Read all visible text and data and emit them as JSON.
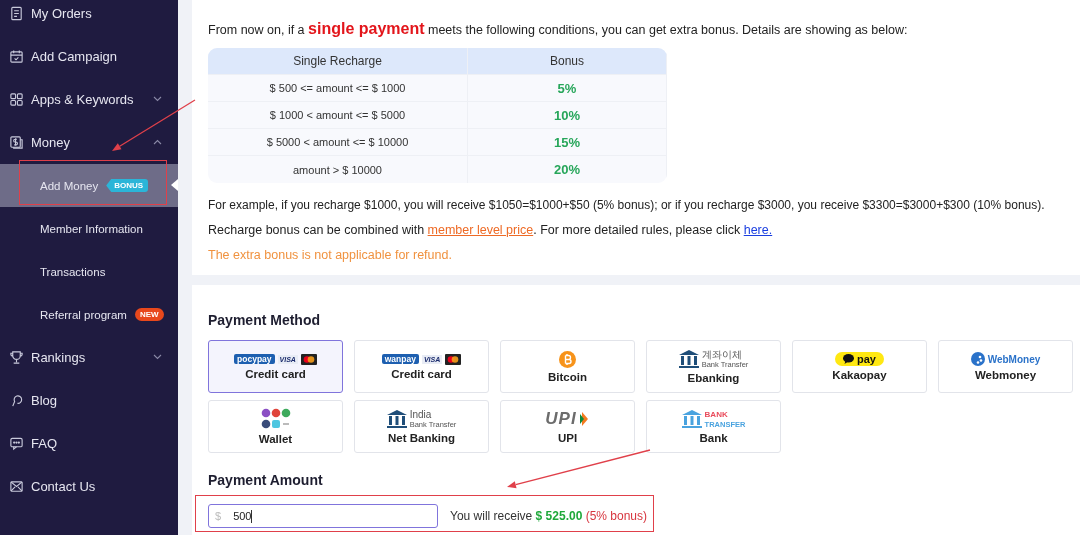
{
  "sidebar": {
    "items": [
      {
        "label": "My Orders"
      },
      {
        "label": "Add Campaign"
      },
      {
        "label": "Apps & Keywords",
        "expanded": false
      },
      {
        "label": "Money",
        "expanded": true,
        "children": [
          {
            "label": "Add Money",
            "selected": true,
            "annotated": true,
            "badge": {
              "kind": "bonus",
              "text": "BONUS"
            }
          },
          {
            "label": "Member Information",
            "selected": false
          },
          {
            "label": "Transactions",
            "selected": false
          },
          {
            "label": "Referral program",
            "selected": false,
            "badge": {
              "kind": "new",
              "text": "NEW"
            }
          }
        ]
      },
      {
        "label": "Rankings",
        "expanded": false
      },
      {
        "label": "Blog"
      },
      {
        "label": "FAQ"
      },
      {
        "label": "Contact Us"
      }
    ]
  },
  "bonus_info": {
    "intro": "From now on, if a **single payment** meets the following conditions, you can get extra bonus. Details are showing as below:",
    "table": {
      "columns": [
        "Single Recharge",
        "Bonus"
      ],
      "rows": [
        [
          "$ 500 <= amount <= $ 1000",
          "5%"
        ],
        [
          "$ 1000 < amount <= $ 5000",
          "10%"
        ],
        [
          "$ 5000 < amount <= $ 10000",
          "15%"
        ],
        [
          "amount > $ 10000",
          "20%"
        ]
      ]
    },
    "example": "For example, if you recharge $1000, you will receive $1050=$1000+$50 (5% bonus); or if you recharge $3000, you receive $3300=$3000+$300 (10% bonus).",
    "note_parts": [
      {
        "kind": "text",
        "text": "Recharge bonus can be combined with "
      },
      {
        "kind": "level_link",
        "text": "member level price"
      },
      {
        "kind": "text",
        "text": ". For more detailed rules, please click "
      },
      {
        "kind": "link",
        "text": "here."
      }
    ],
    "warning": "The extra bonus is not applicable for refund."
  },
  "payment_method": {
    "title": "Payment Method",
    "methods": [
      {
        "label": "Credit card",
        "kind": "cardpay",
        "logo_texts": [
          "pocypay",
          "VISA"
        ],
        "selected": true
      },
      {
        "label": "Credit card",
        "kind": "cardpay",
        "logo_texts": [
          "wanpay",
          "VISA"
        ],
        "selected": false
      },
      {
        "label": "Bitcoin",
        "kind": "coin",
        "selected": false
      },
      {
        "label": "Ebanking",
        "kind": "bank",
        "logo_texts": [
          "계좌이체",
          "Bank Transfer"
        ],
        "selected": false
      },
      {
        "label": "Kakaopay",
        "kind": "kakao",
        "logo_texts": [
          "pay"
        ],
        "selected": false
      },
      {
        "label": "Webmoney",
        "kind": "webmoney",
        "logo_texts": [
          "WebMoney"
        ],
        "selected": false
      },
      {
        "label": "Wallet",
        "kind": "wallet",
        "selected": false
      },
      {
        "label": "Net Banking",
        "kind": "bank",
        "logo_texts": [
          "India",
          "Bank Transfer"
        ],
        "selected": false
      },
      {
        "label": "UPI",
        "kind": "upi",
        "logo_texts": [
          "UPI"
        ],
        "selected": false
      },
      {
        "label": "Bank",
        "kind": "banklight",
        "logo_texts": [
          "BANK",
          "TRANSFER"
        ],
        "selected": false
      }
    ]
  },
  "payment_amount": {
    "title": "Payment Amount",
    "annotated": true,
    "currency": "$",
    "value": "500",
    "receive_label": "You will receive ",
    "receive_amount": "$ 525.00",
    "receive_bonus": "(5% bonus)"
  }
}
